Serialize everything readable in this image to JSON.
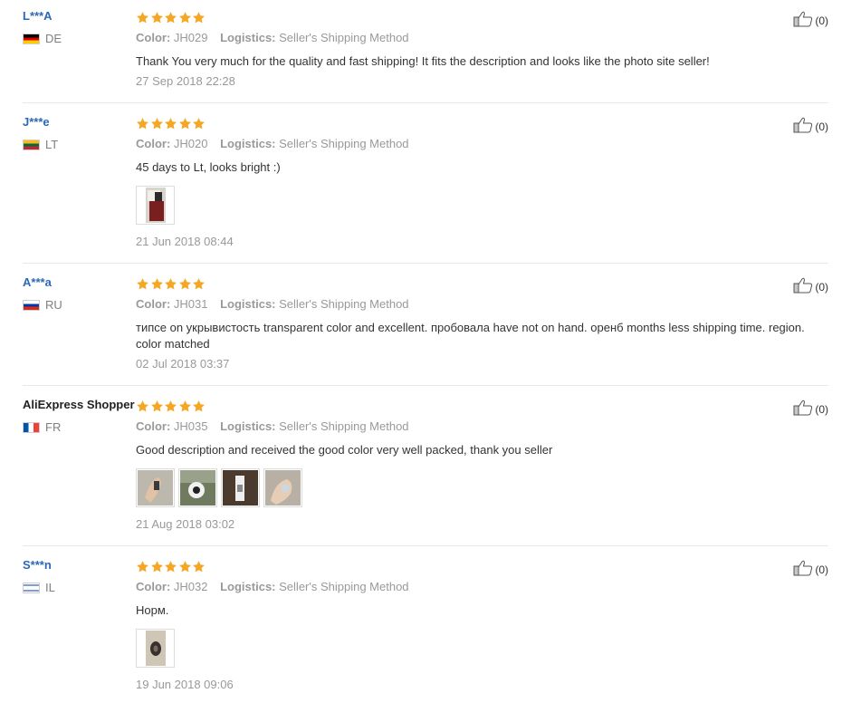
{
  "labels": {
    "color": "Color:",
    "logistics": "Logistics:"
  },
  "colors": {
    "username": "#2c69b5",
    "star": "#f5a623",
    "muted": "#999999",
    "border": "#e8e8e8"
  },
  "reviews": [
    {
      "user": "L***A",
      "country": "DE",
      "rating": 5,
      "color": "JH029",
      "logistics": "Seller's Shipping Method",
      "content": "Thank You very much for the quality and fast shipping! It fits the description and looks like the photo site seller!",
      "photos": [],
      "date": "27 Sep 2018 22:28",
      "likes": "(0)"
    },
    {
      "user": "J***e",
      "country": "LT",
      "rating": 5,
      "color": "JH020",
      "logistics": "Seller's Shipping Method",
      "content": "45 days to Lt, looks bright :)",
      "photos": [
        "photo-1"
      ],
      "date": "21 Jun 2018 08:44",
      "likes": "(0)"
    },
    {
      "user": "A***a",
      "country": "RU",
      "rating": 5,
      "color": "JH031",
      "logistics": "Seller's Shipping Method",
      "content": "типсе on укрывистость transparent color and excellent. пробовала have not on hand. оренб months less shipping time. region. color matched",
      "photos": [],
      "date": "02 Jul 2018 03:37",
      "likes": "(0)"
    },
    {
      "user": "AliExpress Shopper",
      "country": "FR",
      "rating": 5,
      "color": "JH035",
      "logistics": "Seller's Shipping Method",
      "content": "Good description and received the good color very well packed, thank you seller",
      "photos": [
        "photo-1",
        "photo-2",
        "photo-3",
        "photo-4"
      ],
      "date": "21 Aug 2018 03:02",
      "likes": "(0)"
    },
    {
      "user": "S***n",
      "country": "IL",
      "rating": 5,
      "color": "JH032",
      "logistics": "Seller's Shipping Method",
      "content": "Норм.",
      "photos": [
        "photo-1"
      ],
      "date": "19 Jun 2018 09:06",
      "likes": "(0)"
    }
  ]
}
